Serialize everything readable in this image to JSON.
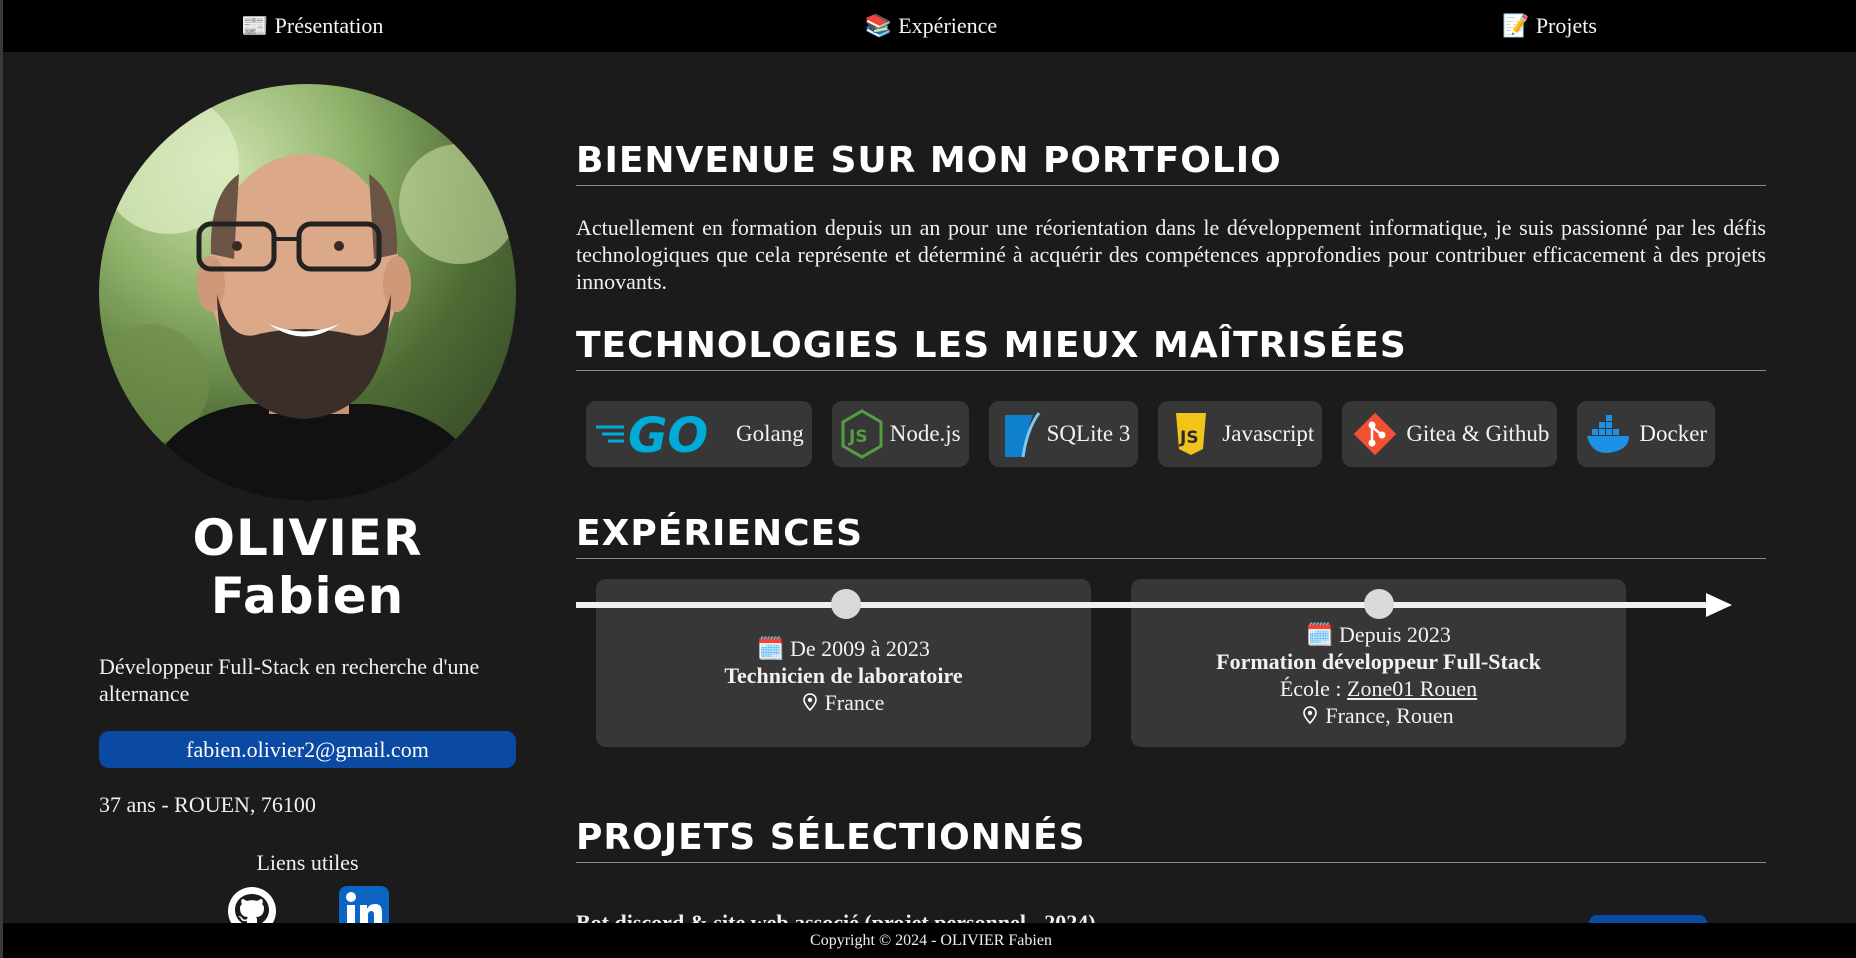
{
  "nav": {
    "items": [
      {
        "emoji": "📰",
        "label": "Présentation"
      },
      {
        "emoji": "📚",
        "label": "Expérience"
      },
      {
        "emoji": "📝",
        "label": "Projets"
      }
    ]
  },
  "profile": {
    "first_name": "OLIVIER",
    "last_name": "Fabien",
    "role": "Développeur Full-Stack en recherche d'une alternance",
    "email": "fabien.olivier2@gmail.com",
    "age_location": "37 ans - ROUEN, 76100",
    "links_title": "Liens utiles",
    "social": [
      "github-icon",
      "linkedin-icon"
    ]
  },
  "welcome": {
    "title": "Bienvenue sur mon portfolio",
    "text": "Actuellement en formation depuis un an pour une réorientation dans le développement informatique, je suis passionné par les défis technologiques que cela représente et déterminé à acquérir des compétences approfondies pour contribuer efficacement à des projets innovants."
  },
  "technologies": {
    "title": "Technologies les mieux maîtrisées",
    "items": [
      {
        "label": "Golang",
        "icon": "go-icon",
        "color": "#00acd7"
      },
      {
        "label": "Node.js",
        "icon": "nodejs-icon",
        "color": "#539e43"
      },
      {
        "label": "SQLite 3",
        "icon": "sqlite-icon",
        "color": "#0f80cc"
      },
      {
        "label": "Javascript",
        "icon": "javascript-icon",
        "color": "#f0c419"
      },
      {
        "label": "Gitea & Github",
        "icon": "git-icon",
        "color": "#f05133"
      },
      {
        "label": "Docker",
        "icon": "docker-icon",
        "color": "#1d91e6"
      }
    ]
  },
  "experiences": {
    "title": "Expériences",
    "items": [
      {
        "emoji": "🗓️",
        "period": "De 2009 à 2023",
        "title": "Technicien de laboratoire",
        "location": "France"
      },
      {
        "emoji": "🗓️",
        "period": "Depuis 2023",
        "title": "Formation développeur Full-Stack",
        "school_label": "École :",
        "school": "Zone01 Rouen",
        "location": "France, Rouen"
      }
    ]
  },
  "projects": {
    "title": "Projets sélectionnés",
    "first_item": "Bot discord & site web associé (projet personnel - 2024)"
  },
  "footer": {
    "copyright": "Copyright © 2024 - OLIVIER Fabien"
  }
}
